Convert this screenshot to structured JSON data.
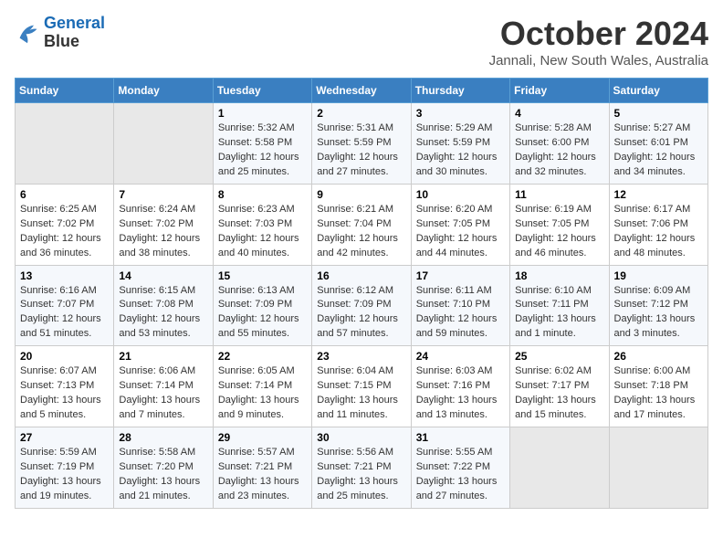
{
  "logo": {
    "line1": "General",
    "line2": "Blue"
  },
  "title": "October 2024",
  "location": "Jannali, New South Wales, Australia",
  "days_of_week": [
    "Sunday",
    "Monday",
    "Tuesday",
    "Wednesday",
    "Thursday",
    "Friday",
    "Saturday"
  ],
  "weeks": [
    [
      {
        "day": "",
        "info": ""
      },
      {
        "day": "",
        "info": ""
      },
      {
        "day": "1",
        "sunrise": "5:32 AM",
        "sunset": "5:58 PM",
        "daylight": "12 hours and 25 minutes."
      },
      {
        "day": "2",
        "sunrise": "5:31 AM",
        "sunset": "5:59 PM",
        "daylight": "12 hours and 27 minutes."
      },
      {
        "day": "3",
        "sunrise": "5:29 AM",
        "sunset": "5:59 PM",
        "daylight": "12 hours and 30 minutes."
      },
      {
        "day": "4",
        "sunrise": "5:28 AM",
        "sunset": "6:00 PM",
        "daylight": "12 hours and 32 minutes."
      },
      {
        "day": "5",
        "sunrise": "5:27 AM",
        "sunset": "6:01 PM",
        "daylight": "12 hours and 34 minutes."
      }
    ],
    [
      {
        "day": "6",
        "sunrise": "6:25 AM",
        "sunset": "7:02 PM",
        "daylight": "12 hours and 36 minutes."
      },
      {
        "day": "7",
        "sunrise": "6:24 AM",
        "sunset": "7:02 PM",
        "daylight": "12 hours and 38 minutes."
      },
      {
        "day": "8",
        "sunrise": "6:23 AM",
        "sunset": "7:03 PM",
        "daylight": "12 hours and 40 minutes."
      },
      {
        "day": "9",
        "sunrise": "6:21 AM",
        "sunset": "7:04 PM",
        "daylight": "12 hours and 42 minutes."
      },
      {
        "day": "10",
        "sunrise": "6:20 AM",
        "sunset": "7:05 PM",
        "daylight": "12 hours and 44 minutes."
      },
      {
        "day": "11",
        "sunrise": "6:19 AM",
        "sunset": "7:05 PM",
        "daylight": "12 hours and 46 minutes."
      },
      {
        "day": "12",
        "sunrise": "6:17 AM",
        "sunset": "7:06 PM",
        "daylight": "12 hours and 48 minutes."
      }
    ],
    [
      {
        "day": "13",
        "sunrise": "6:16 AM",
        "sunset": "7:07 PM",
        "daylight": "12 hours and 51 minutes."
      },
      {
        "day": "14",
        "sunrise": "6:15 AM",
        "sunset": "7:08 PM",
        "daylight": "12 hours and 53 minutes."
      },
      {
        "day": "15",
        "sunrise": "6:13 AM",
        "sunset": "7:09 PM",
        "daylight": "12 hours and 55 minutes."
      },
      {
        "day": "16",
        "sunrise": "6:12 AM",
        "sunset": "7:09 PM",
        "daylight": "12 hours and 57 minutes."
      },
      {
        "day": "17",
        "sunrise": "6:11 AM",
        "sunset": "7:10 PM",
        "daylight": "12 hours and 59 minutes."
      },
      {
        "day": "18",
        "sunrise": "6:10 AM",
        "sunset": "7:11 PM",
        "daylight": "13 hours and 1 minute."
      },
      {
        "day": "19",
        "sunrise": "6:09 AM",
        "sunset": "7:12 PM",
        "daylight": "13 hours and 3 minutes."
      }
    ],
    [
      {
        "day": "20",
        "sunrise": "6:07 AM",
        "sunset": "7:13 PM",
        "daylight": "13 hours and 5 minutes."
      },
      {
        "day": "21",
        "sunrise": "6:06 AM",
        "sunset": "7:14 PM",
        "daylight": "13 hours and 7 minutes."
      },
      {
        "day": "22",
        "sunrise": "6:05 AM",
        "sunset": "7:14 PM",
        "daylight": "13 hours and 9 minutes."
      },
      {
        "day": "23",
        "sunrise": "6:04 AM",
        "sunset": "7:15 PM",
        "daylight": "13 hours and 11 minutes."
      },
      {
        "day": "24",
        "sunrise": "6:03 AM",
        "sunset": "7:16 PM",
        "daylight": "13 hours and 13 minutes."
      },
      {
        "day": "25",
        "sunrise": "6:02 AM",
        "sunset": "7:17 PM",
        "daylight": "13 hours and 15 minutes."
      },
      {
        "day": "26",
        "sunrise": "6:00 AM",
        "sunset": "7:18 PM",
        "daylight": "13 hours and 17 minutes."
      }
    ],
    [
      {
        "day": "27",
        "sunrise": "5:59 AM",
        "sunset": "7:19 PM",
        "daylight": "13 hours and 19 minutes."
      },
      {
        "day": "28",
        "sunrise": "5:58 AM",
        "sunset": "7:20 PM",
        "daylight": "13 hours and 21 minutes."
      },
      {
        "day": "29",
        "sunrise": "5:57 AM",
        "sunset": "7:21 PM",
        "daylight": "13 hours and 23 minutes."
      },
      {
        "day": "30",
        "sunrise": "5:56 AM",
        "sunset": "7:21 PM",
        "daylight": "13 hours and 25 minutes."
      },
      {
        "day": "31",
        "sunrise": "5:55 AM",
        "sunset": "7:22 PM",
        "daylight": "13 hours and 27 minutes."
      },
      {
        "day": "",
        "info": ""
      },
      {
        "day": "",
        "info": ""
      }
    ]
  ]
}
